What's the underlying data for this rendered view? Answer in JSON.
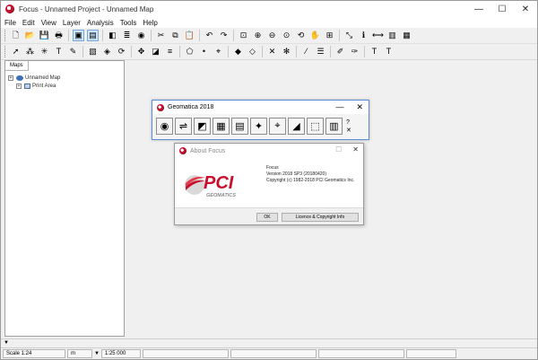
{
  "window": {
    "title": "Focus - Unnamed Project - Unnamed Map",
    "controls": {
      "minimize": "—",
      "maximize": "☐",
      "close": "✕"
    }
  },
  "menu": [
    "File",
    "Edit",
    "View",
    "Layer",
    "Analysis",
    "Tools",
    "Help"
  ],
  "toolbar1_icons": [
    "new-file-icon",
    "open-folder-icon",
    "save-icon",
    "print-icon",
    "|",
    "new-map-icon",
    "open-map-icon",
    "|",
    "eraser-icon",
    "layers-icon",
    "globe-icon",
    "|",
    "cut-icon",
    "copy-icon",
    "paste-icon",
    "|",
    "undo-icon",
    "redo-icon",
    "|",
    "zoom-extent-icon",
    "zoom-in-icon",
    "zoom-out-icon",
    "zoom-layer-icon",
    "zoom-back-icon",
    "pan-hand-icon",
    "zoom-pixel-icon",
    "|",
    "pointer-info-icon",
    "info-icon",
    "measure-icon",
    "chart-icon",
    "grid-icon"
  ],
  "toolbar2_icons": [
    "select-arrow-icon",
    "vertex-edit-icon",
    "lasso-icon",
    "text-icon",
    "pencil-icon",
    "|",
    "fill-icon",
    "shapes-icon",
    "rotate-icon",
    "|",
    "vector-icon",
    "bitmap-icon",
    "line-style-icon",
    "|",
    "polygon-icon",
    "point-icon",
    "cursor-icon",
    "|",
    "layers-stack-icon",
    "tile-icon",
    "|",
    "tools-icon",
    "symbol-icon",
    "|",
    "line-color-icon",
    "fill-style-icon",
    "|",
    "brush-icon",
    "brush-color-icon",
    "|",
    "font-icon",
    "font-size-icon"
  ],
  "toolbar_glyphs": {
    "new-file-icon": "🗋",
    "open-folder-icon": "📂",
    "save-icon": "💾",
    "print-icon": "🖶",
    "new-map-icon": "▣",
    "open-map-icon": "▤",
    "eraser-icon": "◧",
    "layers-icon": "≣",
    "globe-icon": "◉",
    "cut-icon": "✂",
    "copy-icon": "⧉",
    "paste-icon": "📋",
    "undo-icon": "↶",
    "redo-icon": "↷",
    "zoom-extent-icon": "⊡",
    "zoom-in-icon": "⊕",
    "zoom-out-icon": "⊖",
    "zoom-layer-icon": "⊙",
    "zoom-back-icon": "⟲",
    "pan-hand-icon": "✋",
    "zoom-pixel-icon": "⊞",
    "pointer-info-icon": "⤡",
    "info-icon": "ℹ",
    "measure-icon": "⟷",
    "chart-icon": "▥",
    "grid-icon": "▦",
    "select-arrow-icon": "➚",
    "vertex-edit-icon": "⁂",
    "lasso-icon": "✳",
    "text-icon": "T",
    "pencil-icon": "✎",
    "fill-icon": "▧",
    "shapes-icon": "◈",
    "rotate-icon": "⟳",
    "vector-icon": "✥",
    "bitmap-icon": "◪",
    "line-style-icon": "≡",
    "polygon-icon": "⬠",
    "point-icon": "•",
    "cursor-icon": "⌖",
    "layers-stack-icon": "◆",
    "tile-icon": "◇",
    "tools-icon": "✕",
    "symbol-icon": "✻",
    "line-color-icon": "⁄",
    "fill-style-icon": "☰",
    "brush-icon": "✐",
    "brush-color-icon": "✑",
    "font-icon": "T",
    "font-size-icon": "T"
  },
  "maps_panel": {
    "tab_label": "Maps",
    "tree": [
      {
        "label": "Unnamed Map",
        "expander": "+",
        "icon": "map"
      },
      {
        "label": "Print Area",
        "expander": "+",
        "icon": "area"
      }
    ]
  },
  "launcher": {
    "title": "Geomatica 2018",
    "min": "—",
    "close": "✕",
    "buttons": [
      "focus-icon",
      "modeler-icon",
      "easi-icon",
      "orthoengine-icon",
      "chip-manager-icon",
      "smartdigitizer-icon",
      "atmospheric-icon",
      "pansharp-icon",
      "mosaic-icon",
      "geocoding-icon"
    ],
    "button_glyphs": {
      "focus-icon": "◉",
      "modeler-icon": "⇌",
      "easi-icon": "◩",
      "orthoengine-icon": "▦",
      "chip-manager-icon": "▤",
      "smartdigitizer-icon": "✦",
      "atmospheric-icon": "⌖",
      "pansharp-icon": "◢",
      "mosaic-icon": "⬚",
      "geocoding-icon": "▥"
    },
    "extras": [
      "?",
      "✕"
    ]
  },
  "about": {
    "title": "About Focus",
    "info_lines": [
      "Focus",
      "Version 2018 SP3 (20180420)",
      "Copyright (c) 1982-2018 PCI Geomatics Inc."
    ],
    "logo_text": "PCI",
    "logo_sub": "GEOMATICS",
    "ok_label": "OK",
    "license_label": "Licence & Copyright Info"
  },
  "statusbar": {
    "scale": "Scale 1:24",
    "units": "m",
    "extra": "1:25 000"
  },
  "colors": {
    "accent_red": "#c8102e",
    "launcher_border": "#5b8dd6"
  }
}
